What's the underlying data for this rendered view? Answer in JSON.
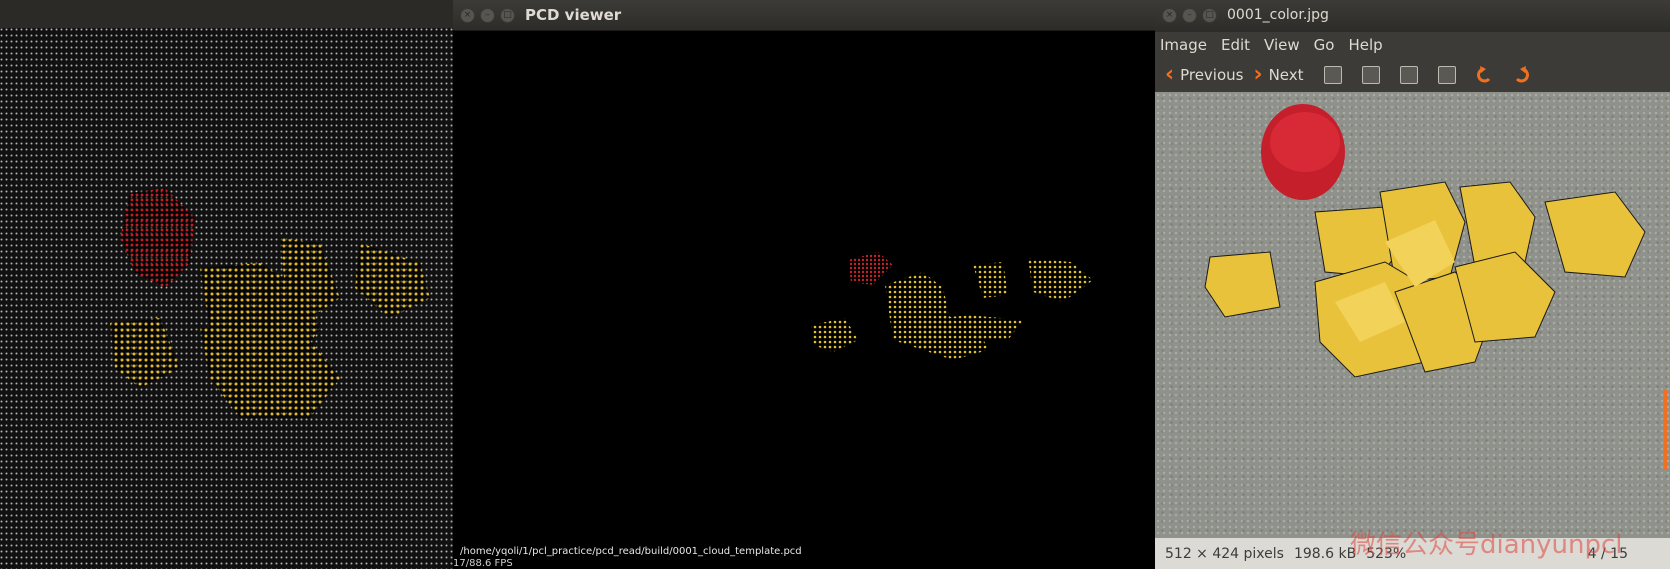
{
  "pcd": {
    "title": "PCD viewer",
    "file_path": "/home/yqoli/1/pcl_practice/pcd_read/build/0001_cloud_template.pcd",
    "fps": "17/88.6 FPS"
  },
  "image_viewer": {
    "title": "0001_color.jpg",
    "menu": [
      "Image",
      "Edit",
      "View",
      "Go",
      "Help"
    ],
    "previous_label": "Previous",
    "next_label": "Next",
    "status": {
      "dimensions": "512 × 424 pixels",
      "file_size": "198.6 kB",
      "zoom": "523%",
      "counter": "4 / 15"
    }
  },
  "watermark": "微信公众号dianyunpcl",
  "colors": {
    "accent": "#f07020",
    "brick_yellow": "#e8c23a",
    "brick_red": "#c51f2c"
  }
}
